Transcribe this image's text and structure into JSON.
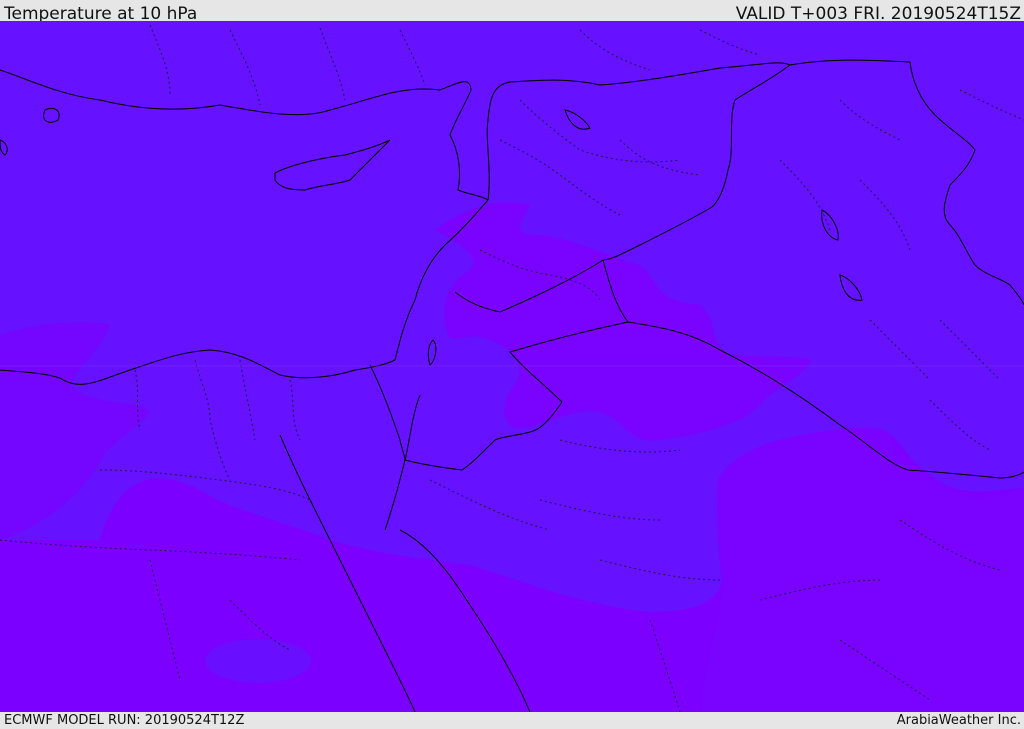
{
  "header": {
    "title": "Temperature at 10 hPa",
    "valid_time": "VALID T+003 FRI. 20190524T15Z"
  },
  "footer": {
    "model_run": "ECMWF MODEL RUN: 20190524T12Z",
    "credit": "ArabiaWeather Inc."
  },
  "map": {
    "colors": {
      "warm_band": "#6611ff",
      "cold_band": "#7c00ff",
      "mid_band": "#6f0bff",
      "boundary_line": "#000000",
      "province_line": "#1a1a4d"
    }
  }
}
